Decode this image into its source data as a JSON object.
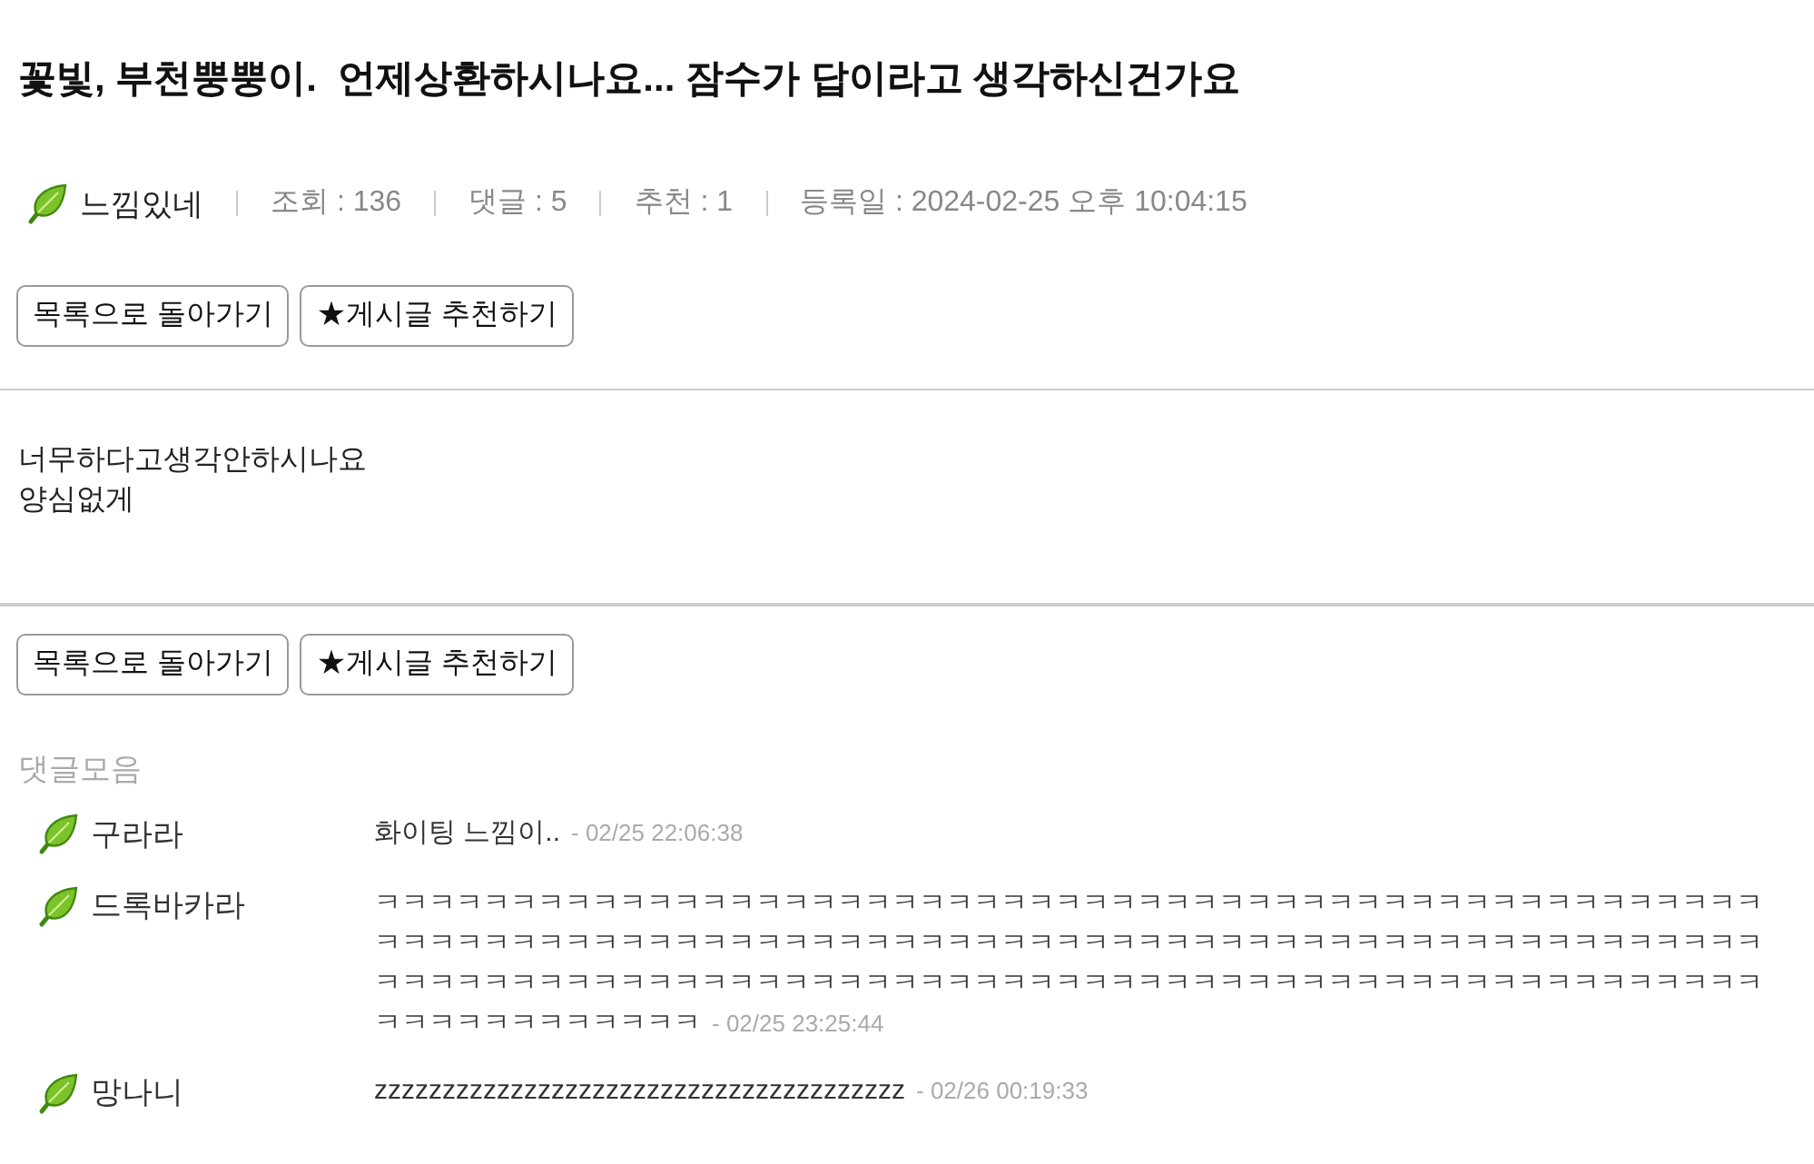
{
  "post": {
    "title": "꽃빛, 부천뿡뿡이.  언제상환하시나요... 잠수가 답이라고 생각하신건가요",
    "author": "느낌있네",
    "stats": [
      "조회 : 136",
      "댓글 : 5",
      "추천 : 1",
      "등록일 : 2024-02-25 오후 10:04:15"
    ],
    "body": [
      "너무하다고생각안하시나요",
      "양심없게"
    ]
  },
  "buttons_top": [
    "목록으로 돌아가기",
    "★게시글 추천하기"
  ],
  "buttons_bottom": [
    "목록으로 돌아가기",
    "★게시글 추천하기"
  ],
  "comments": {
    "heading": "댓글모음",
    "items": [
      {
        "author": "구라라",
        "text": "화이팅 느낌이..",
        "time": "- 02/25 22:06:38"
      },
      {
        "author": "드록바카라",
        "text": "ㅋㅋㅋㅋㅋㅋㅋㅋㅋㅋㅋㅋㅋㅋㅋㅋㅋㅋㅋㅋㅋㅋㅋㅋㅋㅋㅋㅋㅋㅋㅋㅋㅋㅋㅋㅋㅋㅋㅋㅋㅋㅋㅋㅋㅋㅋㅋㅋㅋㅋㅋㅋㅋㅋㅋㅋㅋㅋㅋㅋㅋㅋㅋㅋㅋㅋㅋㅋㅋㅋㅋㅋㅋㅋㅋㅋㅋㅋㅋㅋㅋㅋㅋㅋㅋㅋㅋㅋㅋㅋㅋㅋㅋㅋㅋㅋㅋㅋㅋㅋㅋㅋㅋㅋㅋㅋㅋㅋㅋㅋㅋㅋㅋㅋㅋㅋㅋㅋㅋㅋㅋㅋㅋㅋㅋㅋㅋㅋㅋㅋㅋㅋㅋㅋㅋㅋㅋㅋㅋㅋㅋㅋㅋㅋㅋㅋㅋㅋㅋㅋㅋㅋㅋㅋㅋㅋㅋㅋㅋㅋㅋㅋㅋㅋㅋ",
        "time": "- 02/25 23:25:44"
      },
      {
        "author": "망나니",
        "text": "zzzzzzzzzzzzzzzzzzzzzzzzzzzzzzzzzzzzzzz",
        "time": "- 02/26 00:19:33"
      }
    ]
  }
}
